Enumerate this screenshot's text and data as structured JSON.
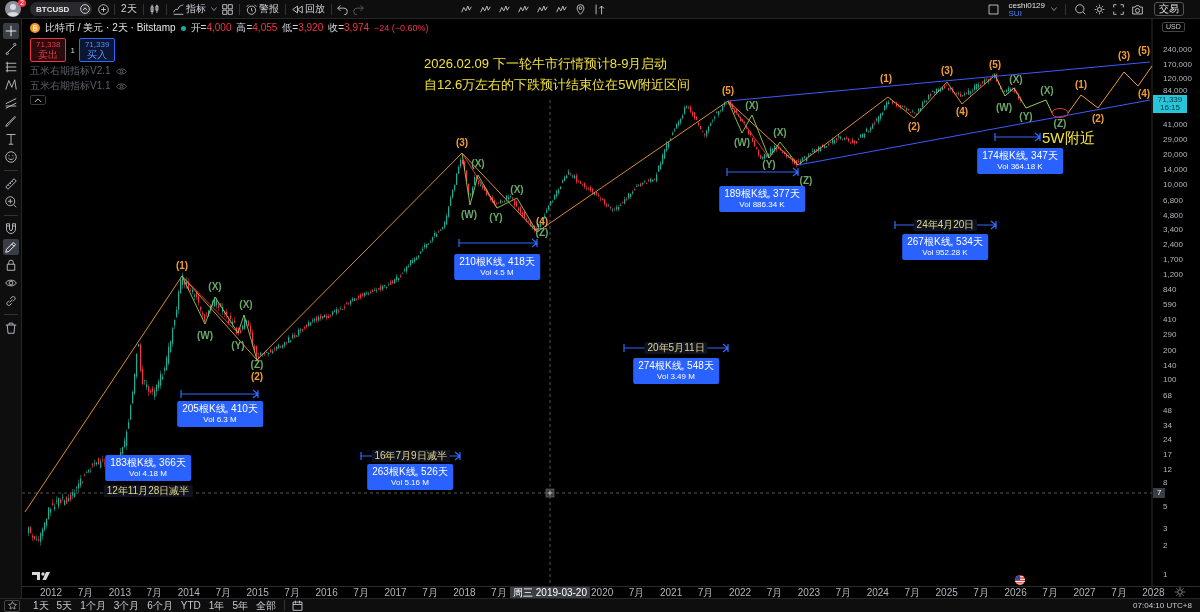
{
  "toolbar": {
    "notifications": "2",
    "symbol": "BTCUSD",
    "interval": "2天",
    "indicators": "指标",
    "alerts": "警报",
    "replay": "回放",
    "user": {
      "name": "ceshi0129",
      "plan": "SUI"
    },
    "trade": "交易"
  },
  "drawing_tools": [
    {
      "selected": true
    },
    {
      "selected": false
    },
    {
      "selected": false
    },
    {
      "selected": false
    },
    {
      "selected": false
    },
    {
      "selected": false
    },
    {
      "selected": false
    },
    {
      "selected": false
    },
    {
      "selected": false
    },
    {
      "selected": false
    },
    {
      "selected": false
    },
    {
      "selected": true
    },
    {
      "selected": false
    },
    {
      "selected": false
    },
    {
      "selected": false
    },
    {
      "selected": false
    }
  ],
  "legend": {
    "title": "比特币 / 美元 · 2天 · Bitstamp",
    "ohlc": [
      {
        "label": "开=",
        "value": "4,000"
      },
      {
        "label": "高=",
        "value": "4,055"
      },
      {
        "label": "低=",
        "value": "3,920"
      },
      {
        "label": "收=",
        "value": "3,974"
      }
    ],
    "change": "−24 (−0.60%)",
    "sell": {
      "price": "71,338",
      "label": "卖出"
    },
    "spread": "1",
    "buy": {
      "price": "71,339",
      "label": "买入"
    },
    "indicators": [
      {
        "name": "五米右期指标V2.1",
        "hidden": true
      },
      {
        "name": "五米右期指标V1.1",
        "hidden": true
      }
    ]
  },
  "annotation": [
    "2026.02.09 下一轮牛市行情预计8-9月启动",
    "自12.6万左右的下跌预计结束位在5W附近区间"
  ],
  "target_label": "5W附近",
  "waves": [
    {
      "text": "(1)",
      "color": "#f29d38"
    },
    {
      "text": "(X)",
      "color": "#6aa86a"
    },
    {
      "text": "(W)",
      "color": "#6aa86a"
    },
    {
      "text": "(X)",
      "color": "#6aa86a"
    },
    {
      "text": "(Y)",
      "color": "#6aa86a"
    },
    {
      "text": "(Z)",
      "color": "#6aa86a"
    },
    {
      "text": "(2)",
      "color": "#f29d38"
    },
    {
      "text": "(3)",
      "color": "#f29d38"
    },
    {
      "text": "(X)",
      "color": "#6aa86a"
    },
    {
      "text": "(W)",
      "color": "#6aa86a"
    },
    {
      "text": "(Y)",
      "color": "#6aa86a"
    },
    {
      "text": "(X)",
      "color": "#6aa86a"
    },
    {
      "text": "(4)",
      "color": "#f29d38"
    },
    {
      "text": "(Z)",
      "color": "#6aa86a"
    },
    {
      "text": "(5)",
      "color": "#f29d38"
    },
    {
      "text": "(X)",
      "color": "#6aa86a"
    },
    {
      "text": "(W)",
      "color": "#6aa86a"
    },
    {
      "text": "(X)",
      "color": "#6aa86a"
    },
    {
      "text": "(Y)",
      "color": "#6aa86a"
    },
    {
      "text": "(Z)",
      "color": "#6aa86a"
    },
    {
      "text": "(1)",
      "color": "#f29d38"
    },
    {
      "text": "(2)",
      "color": "#f29d38"
    },
    {
      "text": "(3)",
      "color": "#f29d38"
    },
    {
      "text": "(4)",
      "color": "#f29d38"
    },
    {
      "text": "(5)",
      "color": "#f29d38"
    },
    {
      "text": "(X)",
      "color": "#6aa86a"
    },
    {
      "text": "(W)",
      "color": "#6aa86a"
    },
    {
      "text": "(X)",
      "color": "#6aa86a"
    },
    {
      "text": "(Y)",
      "color": "#6aa86a"
    },
    {
      "text": "(Z)",
      "color": "#6aa86a"
    },
    {
      "text": "(1)",
      "color": "#f29d38"
    },
    {
      "text": "(2)",
      "color": "#f29d38"
    },
    {
      "text": "(3)",
      "color": "#f29d38"
    },
    {
      "text": "(4)",
      "color": "#f29d38"
    },
    {
      "text": "(5)",
      "color": "#f29d38"
    }
  ],
  "date_ranges": [
    {
      "note": "12年11月28日减半",
      "bars": "183根K线, 366天",
      "volume": "Vol 4.18 M"
    },
    {
      "bars": "205根K线, 410天",
      "volume": "Vol 6.3 M"
    },
    {
      "note": "16年7月9日减半",
      "bars": "263根K线, 526天",
      "volume": "Vol 5.16 M"
    },
    {
      "bars": "210根K线, 418天",
      "volume": "Vol 4.5 M"
    },
    {
      "note": "20年5月11日",
      "bars": "274根K线, 548天",
      "volume": "Vol 3.49 M"
    },
    {
      "bars": "189根K线, 377天",
      "volume": "Vol 886.34 K"
    },
    {
      "note": "24年4月20日",
      "bars": "267根K线, 534天",
      "volume": "Vol 952.28 K"
    },
    {
      "bars": "174根K线, 347天",
      "volume": "Vol 364.18 K"
    }
  ],
  "price_axis": {
    "currency": "USD",
    "labels": [
      "240,000",
      "170,000",
      "120,000",
      "84,000",
      "41,000",
      "29,000",
      "20,000",
      "14,000",
      "10,000",
      "6,800",
      "4,800",
      "3,400",
      "2,400",
      "1,700",
      "1,200",
      "840",
      "590",
      "410",
      "290",
      "200",
      "140",
      "100",
      "68",
      "48",
      "34",
      "24",
      "17",
      "12",
      "8",
      "5",
      "3",
      "2",
      "1"
    ],
    "last_price": "71,339",
    "countdown": "16:15",
    "crosshair_price": "7"
  },
  "time_axis": {
    "labels": [
      "2012",
      "7月",
      "2013",
      "7月",
      "2014",
      "7月",
      "2015",
      "7月",
      "2016",
      "7月",
      "2017",
      "7月",
      "2018",
      "7月",
      "2020",
      "7月",
      "2021",
      "7月",
      "2022",
      "7月",
      "2023",
      "7月",
      "2024",
      "7月",
      "2025",
      "7月",
      "2026",
      "7月",
      "2027",
      "7月",
      "2028"
    ],
    "crosshair_date": "周三 2019-03-20"
  },
  "range_bar": {
    "ranges": [
      "1天",
      "5天",
      "1个月",
      "3个月",
      "6个月",
      "YTD",
      "1年",
      "5年",
      "全部"
    ],
    "clock": "07:04:10 UTC+8"
  }
}
